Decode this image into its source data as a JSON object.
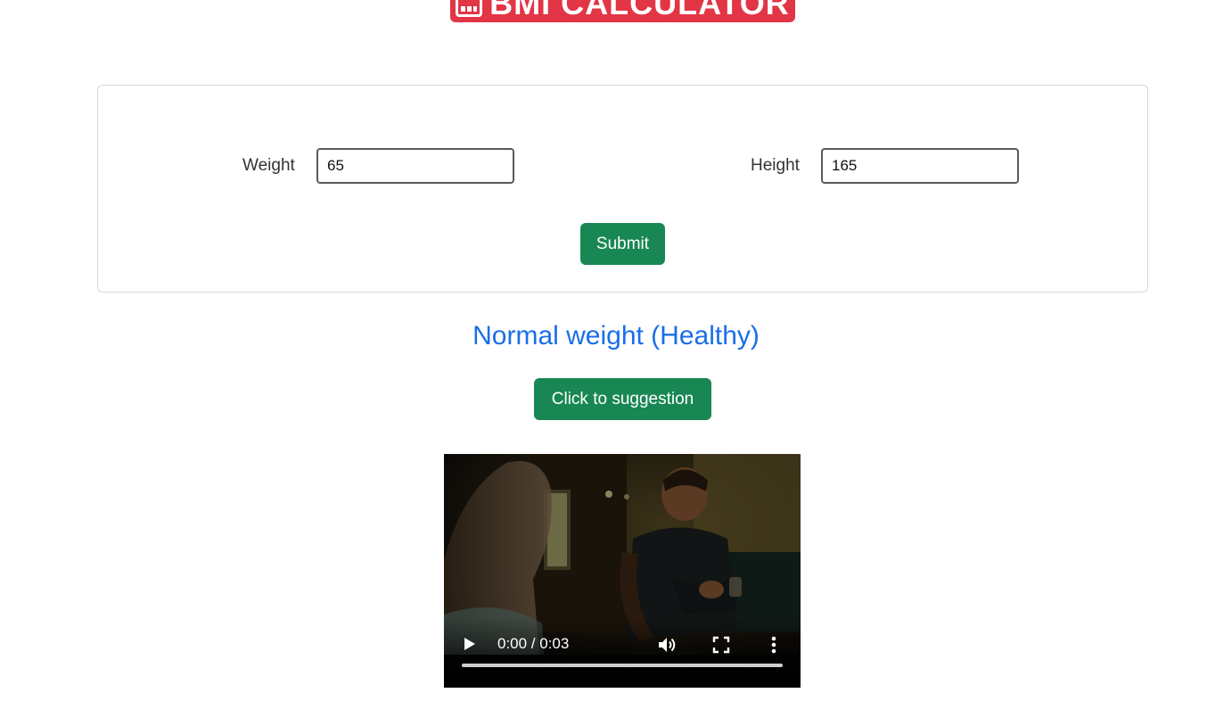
{
  "header": {
    "title": "BMI CALCULATOR",
    "icon": "calculator-icon",
    "color": "#e23545"
  },
  "form": {
    "weight_label": "Weight",
    "weight_value": "65",
    "height_label": "Height",
    "height_value": "165",
    "submit_label": "Submit"
  },
  "result": {
    "text": "Normal weight (Healthy)",
    "color": "#1a6ee8"
  },
  "suggestion": {
    "button_label": "Click to suggestion"
  },
  "video": {
    "time": "0:00 / 0:03",
    "progress": 0,
    "icons": [
      "play-icon",
      "volume-icon",
      "fullscreen-icon",
      "more-options-icon"
    ]
  },
  "colors": {
    "button_green": "#198754"
  }
}
